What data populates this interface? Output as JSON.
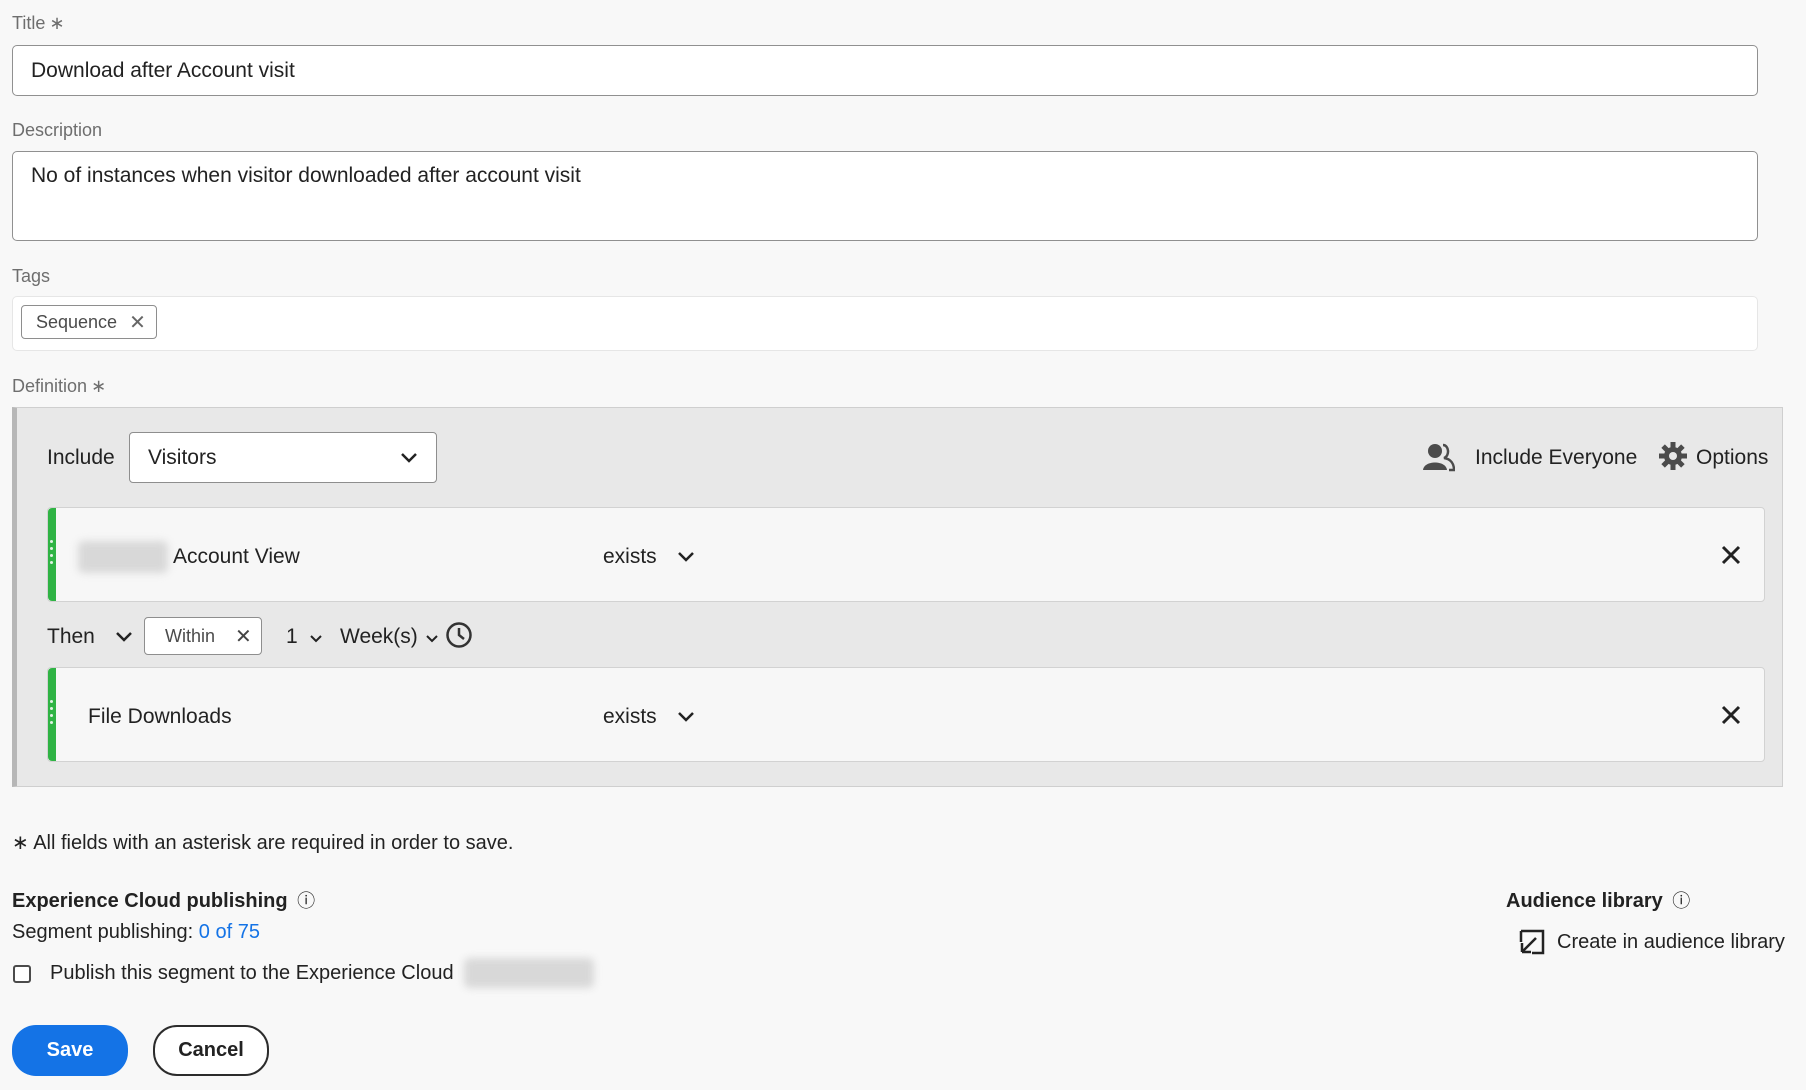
{
  "form": {
    "title_label": "Title",
    "title_value": "Download after Account visit",
    "description_label": "Description",
    "description_value": "No of instances when visitor downloaded after account visit",
    "tags_label": "Tags",
    "tags": [
      "Sequence"
    ],
    "definition_label": "Definition",
    "required_mark": "∗"
  },
  "definition": {
    "include_label": "Include",
    "include_value": "Visitors",
    "include_everyone_label": "Include Everyone",
    "options_label": "Options",
    "rules": [
      {
        "name": "Account View",
        "operator": "exists"
      },
      {
        "name": "File Downloads",
        "operator": "exists"
      }
    ],
    "sequence": {
      "then_label": "Then",
      "within_label": "Within",
      "count": "1",
      "unit": "Week(s)"
    }
  },
  "footer": {
    "required_note": "∗ All fields with an asterisk are required in order to save.",
    "ec_publishing_title": "Experience Cloud publishing",
    "segment_publishing_label": "Segment publishing:",
    "segment_publishing_count": "0 of 75",
    "publish_checkbox_label": "Publish this segment to the Experience Cloud",
    "audience_library_title": "Audience library",
    "create_in_audience_label": "Create in audience library",
    "save_label": "Save",
    "cancel_label": "Cancel"
  },
  "icons": {
    "info": "ⓘ",
    "chevron_down": "chevron-down-icon",
    "close": "close-icon",
    "clock": "clock-icon",
    "users": "users-icon",
    "gear": "gear-icon",
    "external": "open-in-icon"
  },
  "colors": {
    "accent": "#1473e6",
    "rule_bar": "#2fb344"
  }
}
